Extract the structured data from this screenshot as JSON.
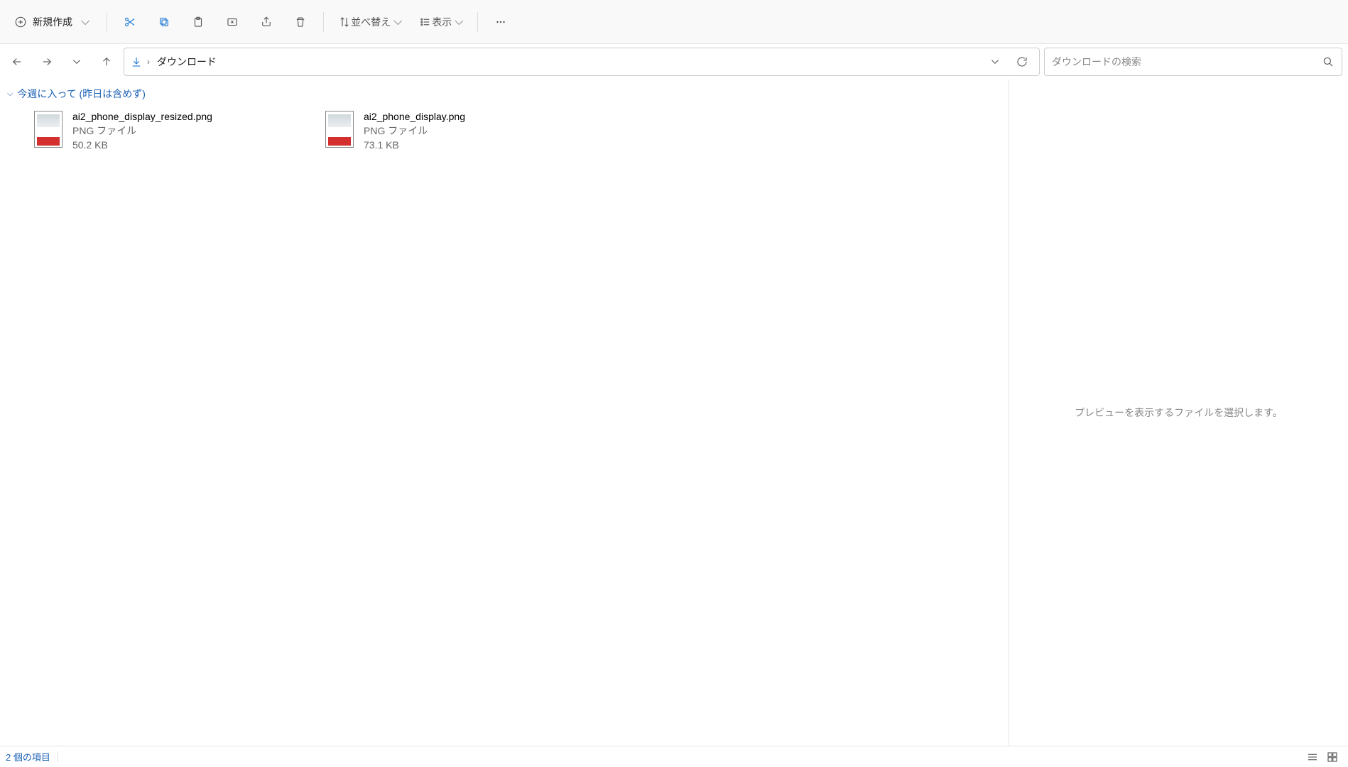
{
  "toolbar": {
    "new_label": "新規作成",
    "sort_label": "並べ替え",
    "view_label": "表示"
  },
  "breadcrumb": {
    "current": "ダウンロード"
  },
  "search": {
    "placeholder": "ダウンロードの検索"
  },
  "group": {
    "header": "今週に入って (昨日は含めず)"
  },
  "files": [
    {
      "name": "ai2_phone_display_resized.png",
      "type": "PNG ファイル",
      "size": "50.2 KB"
    },
    {
      "name": "ai2_phone_display.png",
      "type": "PNG ファイル",
      "size": "73.1 KB"
    }
  ],
  "preview": {
    "empty_text": "プレビューを表示するファイルを選択します。"
  },
  "status": {
    "item_count": "2 個の項目"
  }
}
